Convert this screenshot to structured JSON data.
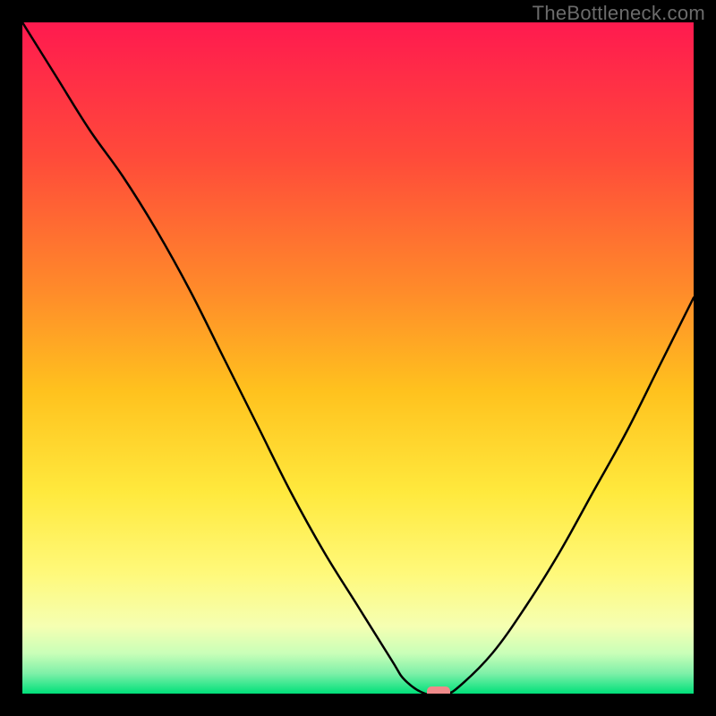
{
  "watermark": "TheBottleneck.com",
  "chart_data": {
    "type": "line",
    "title": "",
    "xlabel": "",
    "ylabel": "",
    "xlim": [
      0,
      100
    ],
    "ylim": [
      0,
      100
    ],
    "x": [
      0,
      5,
      10,
      15,
      20,
      25,
      30,
      35,
      40,
      45,
      50,
      55,
      57,
      60,
      63,
      65,
      70,
      75,
      80,
      85,
      90,
      95,
      100
    ],
    "values": [
      100,
      92,
      84,
      77,
      69,
      60,
      50,
      40,
      30,
      21,
      13,
      5,
      2,
      0,
      0,
      1,
      6,
      13,
      21,
      30,
      39,
      49,
      59
    ],
    "minimum_marker": {
      "x": 62,
      "y": 0
    },
    "gradient_stops": [
      {
        "pos": 0.0,
        "color": "#ff1a4f"
      },
      {
        "pos": 0.2,
        "color": "#ff4a3a"
      },
      {
        "pos": 0.4,
        "color": "#ff8b2a"
      },
      {
        "pos": 0.55,
        "color": "#ffc21e"
      },
      {
        "pos": 0.7,
        "color": "#ffe93d"
      },
      {
        "pos": 0.82,
        "color": "#fff97a"
      },
      {
        "pos": 0.9,
        "color": "#f5ffb2"
      },
      {
        "pos": 0.94,
        "color": "#c9ffb8"
      },
      {
        "pos": 0.97,
        "color": "#7ef0a8"
      },
      {
        "pos": 1.0,
        "color": "#00e07a"
      }
    ]
  }
}
